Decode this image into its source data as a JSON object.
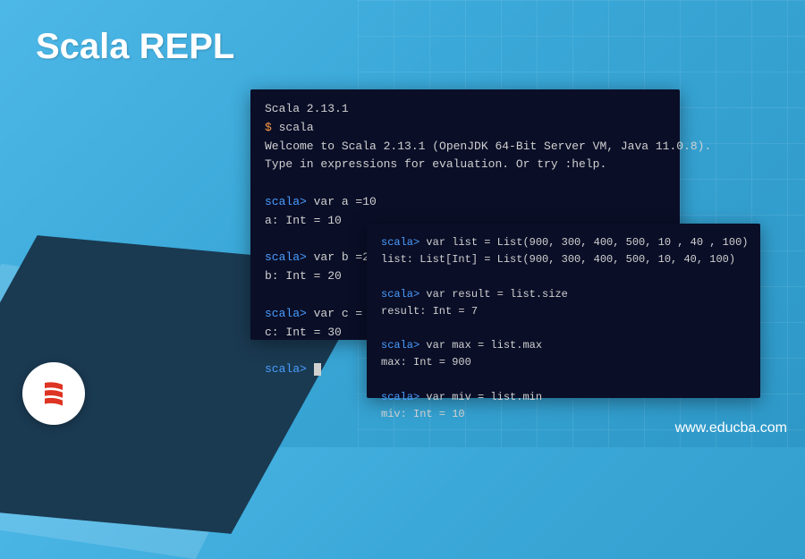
{
  "title": "Scala REPL",
  "terminal1": {
    "version_line": "Scala 2.13.1",
    "cmd_prompt": "$ ",
    "cmd": "scala",
    "welcome1": "Welcome to Scala 2.13.1 (OpenJDK 64-Bit Server VM, Java 11.0.8).",
    "welcome2": "Type in expressions for evaluation. Or try :help.",
    "p": "scala> ",
    "l1_in": "var a =10",
    "l1_out": "a: Int = 10",
    "l2_in": "var b =20",
    "l2_out": "b: Int = 20",
    "l3_in": "var c = a",
    "l3_out": "c: Int = 30"
  },
  "terminal2": {
    "p": "scala> ",
    "l1_in": "var list = List(900, 300, 400, 500, 10 , 40 , 100)",
    "l1_out": "list: List[Int] = List(900, 300, 400, 500, 10, 40, 100)",
    "l2_in": "var result = list.size",
    "l2_out": "result: Int = 7",
    "l3_in": "var max = list.max",
    "l3_out": "max: Int = 900",
    "l4_in": "var miv = list.min",
    "l4_out": "miv: Int = 10"
  },
  "website": "www.educba.com",
  "colors": {
    "bg_gradient_start": "#4db8e8",
    "bg_gradient_end": "#2e98c8",
    "terminal_bg": "#0a0e27",
    "prompt_blue": "#4a9eff",
    "prompt_orange": "#ff9944",
    "scala_red": "#de3423"
  }
}
